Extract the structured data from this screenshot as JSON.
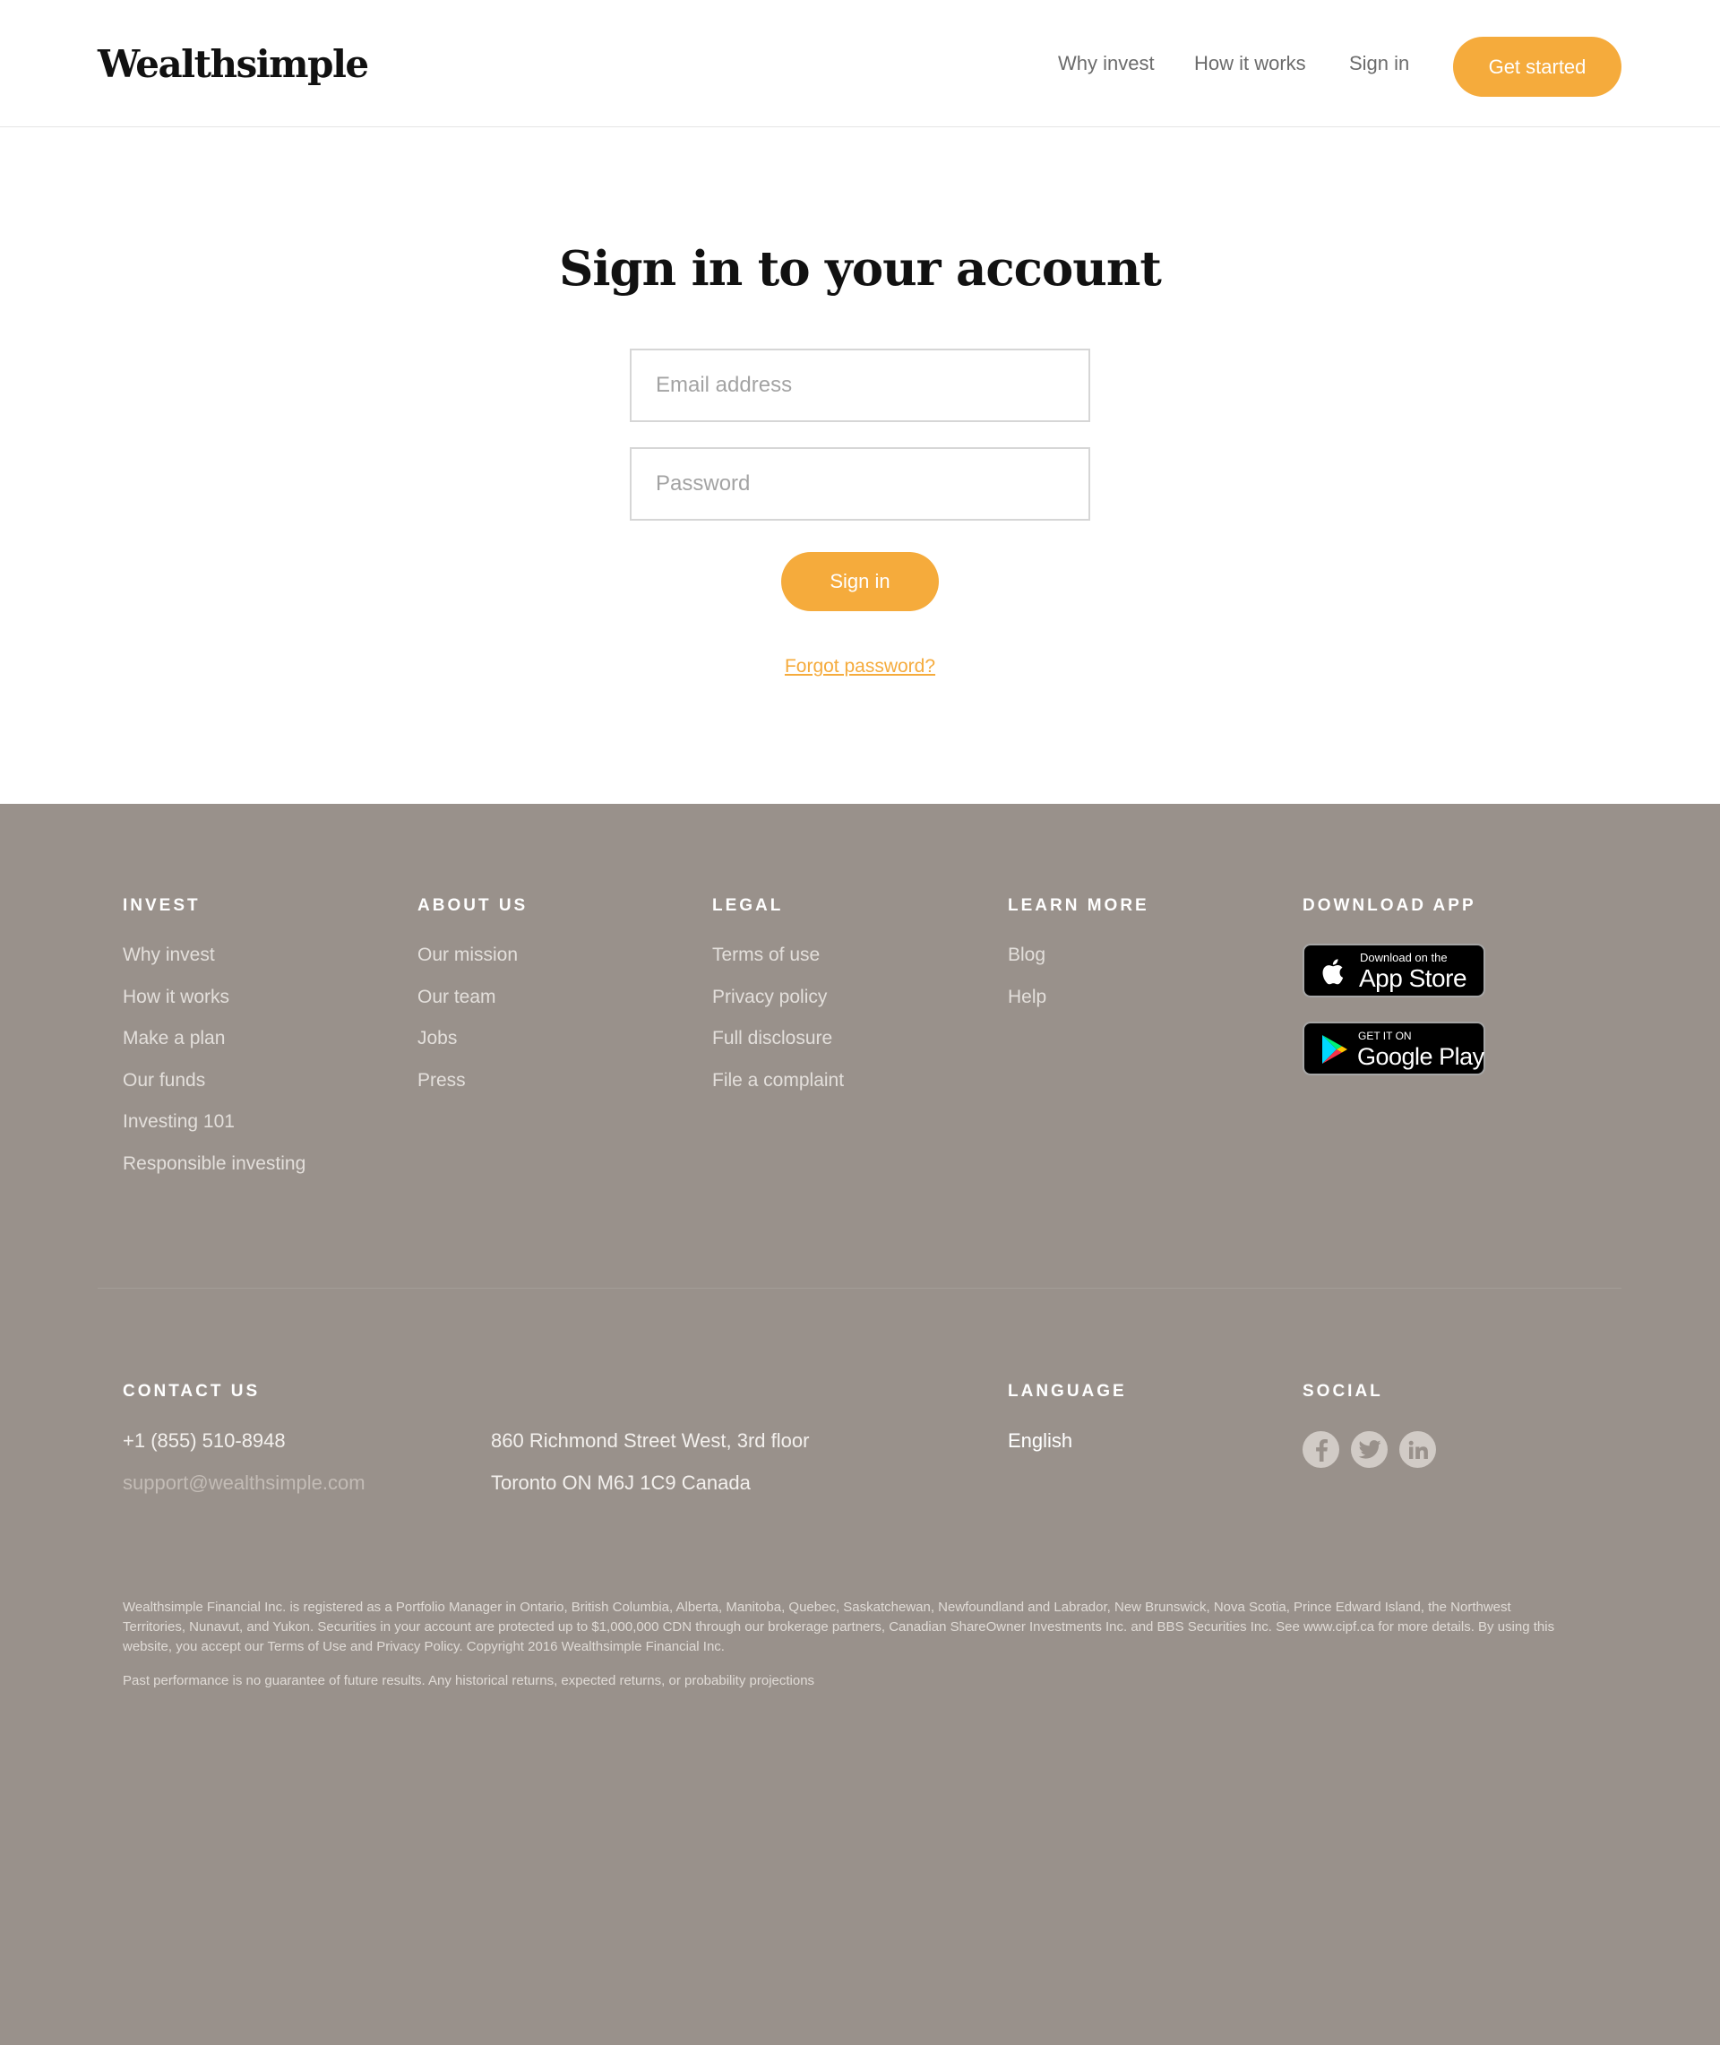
{
  "header": {
    "logo": "Wealthsimple",
    "nav": {
      "why_invest": "Why invest",
      "how_it_works": "How it works",
      "sign_in": "Sign in"
    },
    "cta": "Get started"
  },
  "signin": {
    "title": "Sign in to your account",
    "email_placeholder": "Email address",
    "password_placeholder": "Password",
    "button": "Sign in",
    "forgot": "Forgot password?"
  },
  "footer": {
    "invest": {
      "heading": "INVEST",
      "links": [
        "Why invest",
        "How it works",
        "Make a plan",
        "Our funds",
        "Investing 101",
        "Responsible investing"
      ]
    },
    "about": {
      "heading": "ABOUT US",
      "links": [
        "Our mission",
        "Our team",
        "Jobs",
        "Press"
      ]
    },
    "legal": {
      "heading": "LEGAL",
      "links": [
        "Terms of use",
        "Privacy policy",
        "Full disclosure",
        "File a complaint"
      ]
    },
    "learn": {
      "heading": "LEARN MORE",
      "links": [
        "Blog",
        "Help"
      ]
    },
    "app": {
      "heading": "DOWNLOAD APP",
      "apple_small": "Download on the",
      "apple_big": "App Store",
      "google_small": "GET IT ON",
      "google_big": "Google Play"
    },
    "contact": {
      "heading": "CONTACT US",
      "phone": "+1 (855) 510-8948",
      "email": "support@wealthsimple.com",
      "address_line1": "860 Richmond Street West, 3rd floor",
      "address_line2": "Toronto ON M6J 1C9 Canada"
    },
    "language": {
      "heading": "LANGUAGE",
      "value": "English"
    },
    "social": {
      "heading": "SOCIAL",
      "icons": [
        "facebook-icon",
        "twitter-icon",
        "linkedin-icon"
      ]
    },
    "disclaimer": "Wealthsimple Financial Inc. is registered as a Portfolio Manager in Ontario, British Columbia, Alberta, Manitoba, Quebec, Saskatchewan, Newfoundland and Labrador, New Brunswick, Nova Scotia, Prince Edward Island, the Northwest Territories, Nunavut, and Yukon. Securities in your account are protected up to $1,000,000 CDN through our brokerage partners, Canadian ShareOwner Investments Inc. and BBS Securities Inc. See www.cipf.ca for more details. By using this website, you accept our Terms of Use and Privacy Policy. Copyright 2016 Wealthsimple Financial Inc.",
    "past_performance": "Past performance is no guarantee of future results. Any historical returns, expected returns, or probability projections"
  },
  "colors": {
    "accent": "#f5ab3c",
    "footer_bg": "#99918b"
  }
}
